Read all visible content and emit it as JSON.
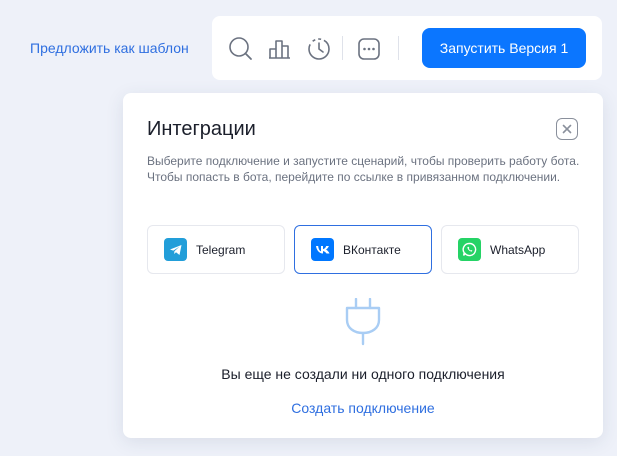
{
  "header": {
    "suggest_template_link": "Предложить как шаблон",
    "run_button_label": "Запустить Версия 1",
    "toolbar_icons": [
      "search-icon",
      "bar-chart-icon",
      "history-icon",
      "more-icon"
    ]
  },
  "integrations": {
    "title": "Интеграции",
    "description": "Выберите подключение и запустите сценарий, чтобы проверить работу бота. Чтобы попасть в бота, перейдите по ссылке в привязанном подключении.",
    "channels": [
      {
        "label": "Telegram",
        "icon": "telegram-icon",
        "color": "#229ED9"
      },
      {
        "label": "ВКонтакте",
        "icon": "vk-icon",
        "color": "#0077FF"
      },
      {
        "label": "WhatsApp",
        "icon": "whatsapp-icon",
        "color": "#25D366"
      }
    ],
    "selected_channel": "ВКонтакте",
    "empty_state_text": "Вы еще не создали ни одного подключения",
    "create_link": "Создать подключение"
  },
  "colors": {
    "accent": "#0B76FF",
    "link": "#2F6FE0",
    "background": "#EEF1F9"
  }
}
